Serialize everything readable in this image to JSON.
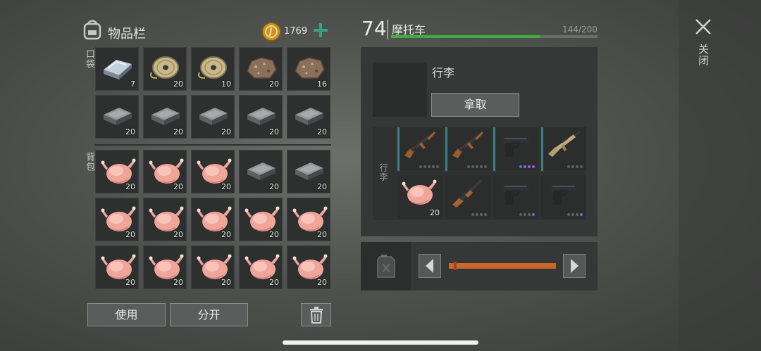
{
  "inventory": {
    "title": "物品栏",
    "coins": "1769",
    "pockets_label": "口袋",
    "backpack_label": "背包",
    "pocket_slots": [
      {
        "item": "steel-ingot-icon",
        "qty": "7"
      },
      {
        "item": "wire-spool-icon",
        "qty": "20"
      },
      {
        "item": "wire-spool-icon",
        "qty": "10"
      },
      {
        "item": "ore-rock-icon",
        "qty": "20"
      },
      {
        "item": "ore-rock-icon",
        "qty": "16"
      },
      {
        "item": "iron-ingot-icon",
        "qty": "20"
      },
      {
        "item": "iron-ingot-icon",
        "qty": "20"
      },
      {
        "item": "iron-ingot-icon",
        "qty": "20"
      },
      {
        "item": "iron-ingot-icon",
        "qty": "20"
      },
      {
        "item": "iron-ingot-icon",
        "qty": "20"
      }
    ],
    "backpack_slots": [
      {
        "item": "raw-chicken-icon",
        "qty": "20"
      },
      {
        "item": "raw-chicken-icon",
        "qty": "20"
      },
      {
        "item": "raw-chicken-icon",
        "qty": "20"
      },
      {
        "item": "iron-ingot-icon",
        "qty": "20"
      },
      {
        "item": "iron-ingot-icon",
        "qty": "20"
      },
      {
        "item": "raw-chicken-icon",
        "qty": "20"
      },
      {
        "item": "raw-chicken-icon",
        "qty": "20"
      },
      {
        "item": "raw-chicken-icon",
        "qty": "20"
      },
      {
        "item": "raw-chicken-icon",
        "qty": "20"
      },
      {
        "item": "raw-chicken-icon",
        "qty": "20"
      },
      {
        "item": "raw-chicken-icon",
        "qty": "20"
      },
      {
        "item": "raw-chicken-icon",
        "qty": "20"
      },
      {
        "item": "raw-chicken-icon",
        "qty": "20"
      },
      {
        "item": "raw-chicken-icon",
        "qty": "20"
      },
      {
        "item": "raw-chicken-icon",
        "qty": "20"
      }
    ],
    "use_label": "使用",
    "split_label": "分开"
  },
  "vehicle": {
    "level": "74",
    "name": "摩托车",
    "durability_text": "144/200",
    "durability_fraction": 0.72,
    "luggage_title": "行李",
    "take_label": "拿取",
    "luggage_label": "行李",
    "luggage_slots": [
      {
        "item": "ak-rifle-icon",
        "qty": ""
      },
      {
        "item": "ak-rifle-icon",
        "qty": ""
      },
      {
        "item": "pistol-icon",
        "qty": ""
      },
      {
        "item": "scar-rifle-icon",
        "qty": ""
      },
      {
        "item": "raw-chicken-icon",
        "qty": "20"
      },
      {
        "item": "shotgun-icon",
        "qty": ""
      },
      {
        "item": "pistol-icon",
        "qty": ""
      },
      {
        "item": "pistol-icon",
        "qty": ""
      }
    ],
    "fuel_level": 0.02
  },
  "close_label": "关闭",
  "colors": {
    "accent": "#3fae3f",
    "fuel": "#c9682a",
    "teal": "#3e7f84"
  }
}
